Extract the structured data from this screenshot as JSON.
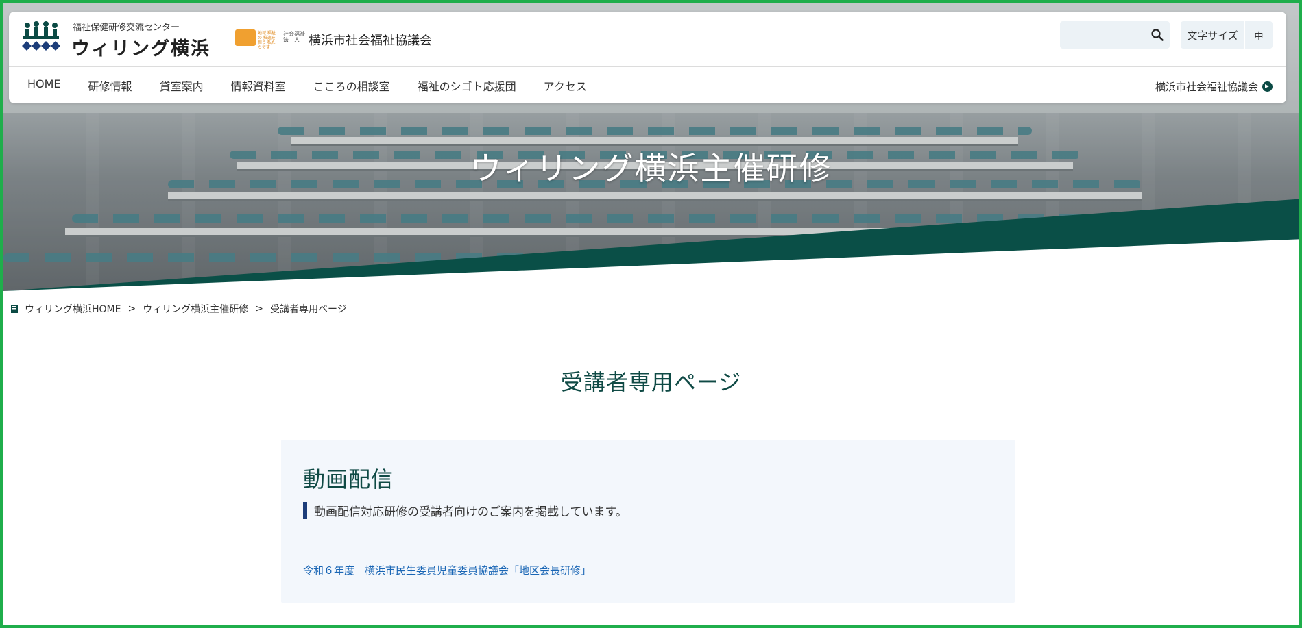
{
  "header": {
    "logo_sub": "福祉保健研修交流センター",
    "logo_main": "ウィリング横浜",
    "assoc_small": "地域 福祉の 推進を担う 私たちです",
    "assoc_corp": "社会福祉 法　人",
    "assoc_name": "横浜市社会福祉協議会",
    "search_placeholder": "",
    "fontsize_label": "文字サイズ",
    "fontsize_value": "中",
    "nav": [
      "HOME",
      "研修情報",
      "貸室案内",
      "情報資料室",
      "こころの相談室",
      "福祉のシゴト応援団",
      "アクセス"
    ],
    "nav_right": "横浜市社会福祉協議会"
  },
  "hero": {
    "title": "ウィリング横浜主催研修"
  },
  "breadcrumb": [
    "ウィリング横浜HOME",
    "ウィリング横浜主催研修",
    "受講者専用ページ"
  ],
  "breadcrumb_sep": ">",
  "page_title": "受講者専用ページ",
  "card": {
    "heading": "動画配信",
    "description": "動画配信対応研修の受講者向けのご案内を掲載しています。",
    "link": "令和６年度　横浜市民生委員児童委員協議会「地区会長研修」"
  },
  "colors": {
    "brand_green": "#0f4a45",
    "hero_band": "#0a4f47",
    "link_blue": "#1a66b5",
    "accent_navy": "#1c3d7a",
    "frame_green": "#1fae4b",
    "assoc_orange": "#f0a030"
  }
}
